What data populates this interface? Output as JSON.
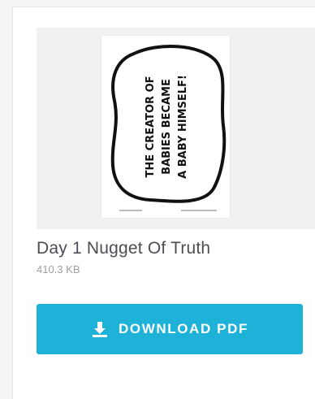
{
  "preview": {
    "lines": [
      "THE CREATOR OF",
      "BABIES BECAME",
      "A BABY HIMSELF!"
    ]
  },
  "file": {
    "title": "Day 1 Nugget Of Truth",
    "size": "410.3 KB"
  },
  "download": {
    "label": "DOWNLOAD PDF",
    "icon": "download-icon",
    "color": "#1fb2d8"
  }
}
